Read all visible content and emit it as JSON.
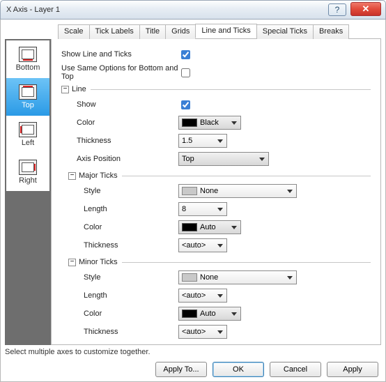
{
  "window": {
    "title": "X Axis - Layer 1"
  },
  "tabs": [
    "Scale",
    "Tick Labels",
    "Title",
    "Grids",
    "Line and Ticks",
    "Special Ticks",
    "Breaks"
  ],
  "active_tab": "Line and Ticks",
  "sidebar": {
    "items": [
      "Bottom",
      "Top",
      "Left",
      "Right"
    ],
    "selected": "Top"
  },
  "panel": {
    "show_line_label": "Show Line and Ticks",
    "use_same_label": "Use Same Options for Bottom and Top",
    "group_line": "Line",
    "group_major": "Major Ticks",
    "group_minor": "Minor Ticks",
    "field": {
      "show": "Show",
      "color": "Color",
      "thickness": "Thickness",
      "axis_position": "Axis Position",
      "style": "Style",
      "length": "Length"
    },
    "values": {
      "line_color": "Black",
      "line_thickness": "1.5",
      "axis_position": "Top",
      "major_style": "None",
      "major_length": "8",
      "major_color": "Auto",
      "major_thickness": "<auto>",
      "minor_style": "None",
      "minor_length": "<auto>",
      "minor_color": "Auto",
      "minor_thickness": "<auto>"
    }
  },
  "footer": {
    "hint": "Select multiple axes to customize together.",
    "buttons": {
      "apply_to": "Apply To...",
      "ok": "OK",
      "cancel": "Cancel",
      "apply": "Apply"
    }
  }
}
